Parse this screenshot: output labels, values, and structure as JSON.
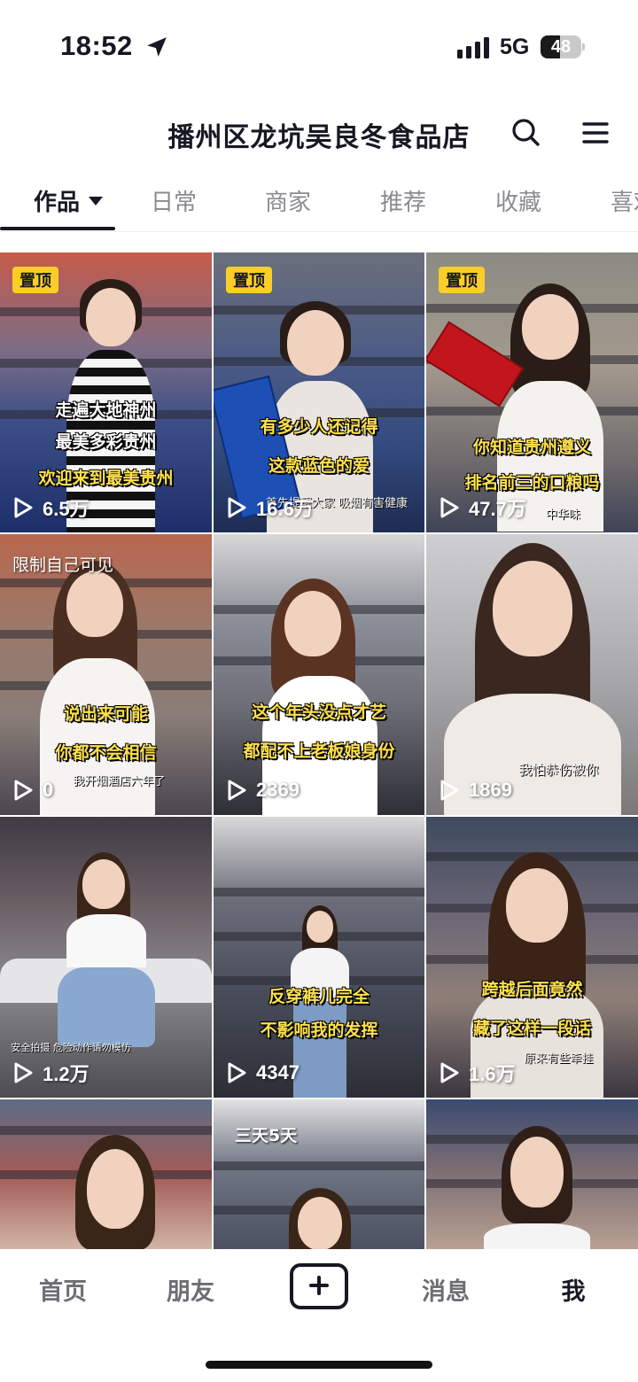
{
  "status_bar": {
    "time": "18:52",
    "network": "5G",
    "battery_level": "48"
  },
  "header": {
    "shop_title": "播州区龙坑吴良冬食品店"
  },
  "tabs": [
    {
      "label": "作品",
      "active": true
    },
    {
      "label": "日常",
      "active": false
    },
    {
      "label": "商家",
      "active": false
    },
    {
      "label": "推荐",
      "active": false
    },
    {
      "label": "收藏",
      "active": false
    },
    {
      "label": "喜欢",
      "active": false
    }
  ],
  "videos": [
    {
      "pinned_label": "置顶",
      "captions": [
        "走遍大地神州",
        "最美多彩贵州",
        "欢迎来到最美贵州"
      ],
      "plays": "6.5万"
    },
    {
      "pinned_label": "置顶",
      "captions": [
        "有多少人还记得",
        "这款蓝色的爱"
      ],
      "small_caption": "首先提醒大家 吸烟有害健康",
      "plays": "16.6万"
    },
    {
      "pinned_label": "置顶",
      "captions": [
        "你知道贵州遵义",
        "排名前三的口粮吗"
      ],
      "small_caption": "中华味",
      "plays": "47.7万"
    },
    {
      "private_label": "限制自己可见",
      "captions": [
        "说出来可能",
        "你都不会相信"
      ],
      "small_caption": "我开烟酒店六年了",
      "plays": "0"
    },
    {
      "captions": [
        "这个年头没点才艺",
        "都配不上老板娘身份"
      ],
      "plays": "2369"
    },
    {
      "small_caption": "我怕恭伤被你",
      "plays": "1869"
    },
    {
      "small_caption": "安全拍摄 危险动作请勿模仿",
      "plays": "1.2万"
    },
    {
      "captions": [
        "反穿裤儿完全",
        "不影响我的发挥"
      ],
      "plays": "4347"
    },
    {
      "captions": [
        "跨越后面竟然",
        "藏了这样一段话"
      ],
      "small_caption": "原来有些牵挂",
      "plays": "1.6万"
    },
    {},
    {
      "top_caption": "三天5天"
    },
    {}
  ],
  "bottom_nav": {
    "home": "首页",
    "friends": "朋友",
    "messages": "消息",
    "me": "我"
  },
  "colors": {
    "pin_badge": "#facd29",
    "caption_yellow": "#ffe14d",
    "text_primary": "#161823",
    "text_secondary": "#8a8b91"
  }
}
